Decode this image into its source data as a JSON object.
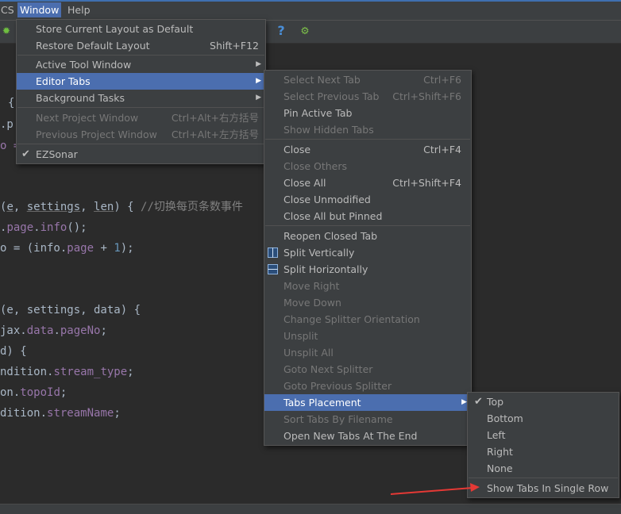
{
  "menubar": {
    "items": [
      {
        "label": "CS"
      },
      {
        "label": "Window"
      },
      {
        "label": "Help"
      }
    ]
  },
  "editor": {
    "lines": [
      {
        "t": "{"
      },
      {
        "t": ".p"
      },
      {
        "t": "o ="
      },
      {
        "a": "(",
        "b": "e",
        "c": ", ",
        "d": "settings",
        "e": ", ",
        "f": "len",
        "g": ") { ",
        "h": "//切换每页条数事件"
      },
      {
        "a": ".",
        "b": "page",
        "c": ".",
        "d": "info",
        "e": "();"
      },
      {
        "a": "o = (info.",
        "b": "page",
        "c": " + ",
        "d": "1",
        "e": ");"
      },
      {
        "t": "(e, settings, data) {"
      },
      {
        "a": "jax.",
        "b": "data",
        "c": ".",
        "d": "pageNo",
        "e": ";"
      },
      {
        "t": "d) {"
      },
      {
        "a": "ndition.",
        "b": "stream_type",
        "c": ";"
      },
      {
        "a": "on.",
        "b": "topoId",
        "c": ";"
      },
      {
        "a": "dition.",
        "b": "streamName",
        "c": ";"
      }
    ]
  },
  "window_menu": {
    "items": [
      {
        "label": "Store Current Layout as Default",
        "shortcut": ""
      },
      {
        "label": "Restore Default Layout",
        "shortcut": "Shift+F12"
      },
      {
        "label": "Active Tool Window",
        "shortcut": ""
      },
      {
        "label": "Editor Tabs",
        "shortcut": ""
      },
      {
        "label": "Background Tasks",
        "shortcut": ""
      },
      {
        "label": "Next Project Window",
        "shortcut": "Ctrl+Alt+右方括号"
      },
      {
        "label": "Previous Project Window",
        "shortcut": "Ctrl+Alt+左方括号"
      },
      {
        "label": "EZSonar",
        "shortcut": ""
      }
    ]
  },
  "editor_tabs_menu": {
    "items": [
      {
        "label": "Select Next Tab",
        "shortcut": "Ctrl+F6"
      },
      {
        "label": "Select Previous Tab",
        "shortcut": "Ctrl+Shift+F6"
      },
      {
        "label": "Pin Active Tab",
        "shortcut": ""
      },
      {
        "label": "Show Hidden Tabs",
        "shortcut": ""
      },
      {
        "label": "Close",
        "shortcut": "Ctrl+F4"
      },
      {
        "label": "Close Others",
        "shortcut": ""
      },
      {
        "label": "Close All",
        "shortcut": "Ctrl+Shift+F4"
      },
      {
        "label": "Close Unmodified",
        "shortcut": ""
      },
      {
        "label": "Close All but Pinned",
        "shortcut": ""
      },
      {
        "label": "Reopen Closed Tab",
        "shortcut": ""
      },
      {
        "label": "Split Vertically",
        "shortcut": ""
      },
      {
        "label": "Split Horizontally",
        "shortcut": ""
      },
      {
        "label": "Move Right",
        "shortcut": ""
      },
      {
        "label": "Move Down",
        "shortcut": ""
      },
      {
        "label": "Change Splitter Orientation",
        "shortcut": ""
      },
      {
        "label": "Unsplit",
        "shortcut": ""
      },
      {
        "label": "Unsplit All",
        "shortcut": ""
      },
      {
        "label": "Goto Next Splitter",
        "shortcut": ""
      },
      {
        "label": "Goto Previous Splitter",
        "shortcut": ""
      },
      {
        "label": "Tabs Placement",
        "shortcut": ""
      },
      {
        "label": "Sort Tabs By Filename",
        "shortcut": ""
      },
      {
        "label": "Open New Tabs At The End",
        "shortcut": ""
      }
    ]
  },
  "tabs_placement_menu": {
    "items": [
      {
        "label": "Top"
      },
      {
        "label": "Bottom"
      },
      {
        "label": "Left"
      },
      {
        "label": "Right"
      },
      {
        "label": "None"
      },
      {
        "label": "Show Tabs In Single Row"
      }
    ]
  },
  "colors": {
    "selection": "#4b6eaf",
    "menu_bg": "#3c3f41",
    "editor_bg": "#2b2b2b",
    "annotation_arrow": "#e53935"
  }
}
